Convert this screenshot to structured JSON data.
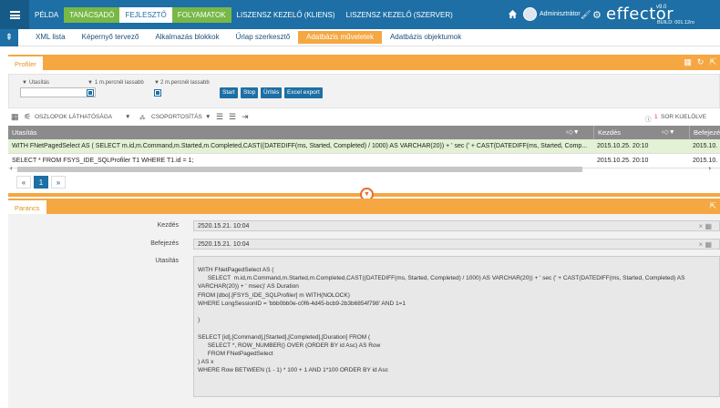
{
  "topnav": [
    "PÉLDA",
    "TANÁCSADÓ",
    "FEJLESZTŐ",
    "FOLYAMATOK",
    "LISZENSZ KEZELŐ (KLIENS)",
    "LISZENSZ KEZELŐ (SZERVER)"
  ],
  "user": {
    "name": "Adminisztrátor"
  },
  "logo": {
    "text": "effector",
    "version": "v9.0",
    "build": "BUILD: 001.12ro"
  },
  "subnav": [
    "XML lista",
    "Képernyő tervező",
    "Alkalmazás blokkok",
    "Űrlap szerkesztő",
    "Adatbázis műveletek",
    "Adatbázis objektumok"
  ],
  "profiler": {
    "tab": "Profiler",
    "filter": {
      "utasitas_label": "Utasítás",
      "slow1_label": "1 m.percnél lassabb",
      "slow2_label": "2 m.percnél lassabb",
      "input_value": "",
      "buttons": [
        "Start",
        "Stop",
        "Ürítés",
        "Excel export"
      ]
    },
    "toolbar": {
      "columns": "OSZLOPOK LÁTHATÓSÁGA",
      "group": "CSOPORTOSÍTÁS",
      "selected_count": "1",
      "selected_label": "SOR KIJELÖLVE"
    },
    "columns": [
      "Utasítás",
      "Kezdés",
      "Befejezés"
    ],
    "rows": [
      {
        "utasitas": "WITH FNetPagedSelect AS ( SELECT m.id,m.Command,m.Started,m.Completed,CAST((DATEDIFF(ms, Started, Completed) / 1000) AS VARCHAR(20)) + ' sec (' + CAST(DATEDIFF(ms, Started, Comp...",
        "kezdes": "2015.10.25. 20:10",
        "befejezes": "2015.10.",
        "selected": true
      },
      {
        "utasitas": "SELECT * FROM FSYS_IDE_SQLProfiler T1 WHERE T1.id = 1;",
        "kezdes": "2015.10.25. 20:10",
        "befejezes": "2015.10.",
        "selected": false
      }
    ],
    "pager": {
      "first": "«",
      "current": "1",
      "next": "»"
    }
  },
  "parancs": {
    "tab": "Parancs",
    "kezdes_label": "Kezdés",
    "kezdes_value": "2520.15.21. 10:04",
    "befejezes_label": "Befejezés",
    "befejezes_value": "2520.15.21. 10:04",
    "utasitas_label": "Utasítás",
    "utasitas_value": "WITH FNetPagedSelect AS (\n      SELECT  m.id,m.Command,m.Started,m.Completed,CAST((DATEDIFF(ms, Started, Completed) / 1000) AS VARCHAR(20)) + ' sec (' + CAST(DATEDIFF(ms, Started, Completed) AS\nVARCHAR(20)) + ' msec)' AS Duration\nFROM [dbo].[FSYS_IDE_SQLProfiler] m WITH(NOLOCK)\nWHERE LongSessionID = 'bbb0bb0e-c0f6-4d45-bcb9-2b3b6854f798' AND 1=1\n\n)\n\nSELECT [id],[Command],[Started],[Completed],[Duration] FROM (\n      SELECT *, ROW_NUMBER() OVER (ORDER BY id Asc) AS Row\n      FROM FNetPagedSelect\n) AS x\nWHERE Row BETWEEN (1 - 1) * 100 + 1 AND 1*100 ORDER BY id Asc"
  },
  "colors": {
    "primary": "#1d6fa5",
    "accent": "#f5a742",
    "green": "#78b847"
  }
}
